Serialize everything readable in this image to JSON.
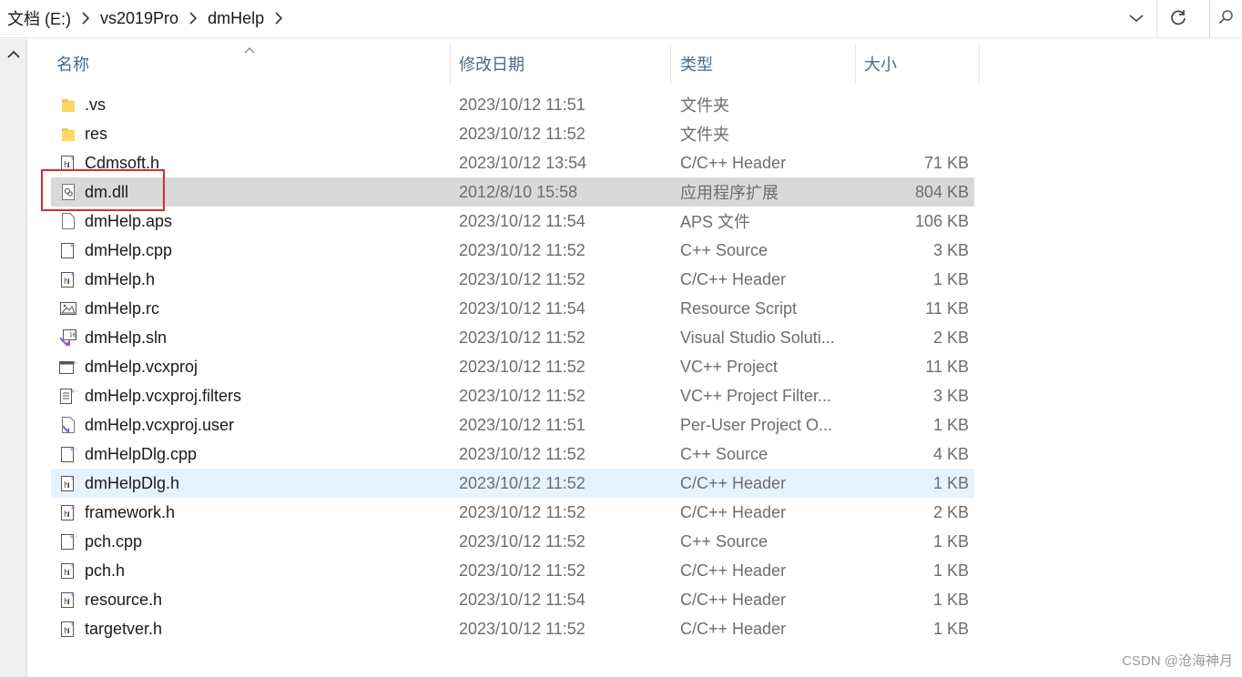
{
  "address": {
    "crumbs": [
      "文档 (E:)",
      "vs2019Pro",
      "dmHelp"
    ]
  },
  "columns": {
    "name": "名称",
    "date": "修改日期",
    "type": "类型",
    "size": "大小"
  },
  "files": [
    {
      "name": ".vs",
      "date": "2023/10/12 11:51",
      "type": "文件夹",
      "size": "",
      "icon": "folder-icon"
    },
    {
      "name": "res",
      "date": "2023/10/12 11:52",
      "type": "文件夹",
      "size": "",
      "icon": "folder-icon"
    },
    {
      "name": "Cdmsoft.h",
      "date": "2023/10/12 13:54",
      "type": "C/C++ Header",
      "size": "71 KB",
      "icon": "header-file-icon"
    },
    {
      "name": "dm.dll",
      "date": "2012/8/10 15:58",
      "type": "应用程序扩展",
      "size": "804 KB",
      "icon": "dll-file-icon"
    },
    {
      "name": "dmHelp.aps",
      "date": "2023/10/12 11:54",
      "type": "APS 文件",
      "size": "106 KB",
      "icon": "blank-file-icon"
    },
    {
      "name": "dmHelp.cpp",
      "date": "2023/10/12 11:52",
      "type": "C++ Source",
      "size": "3 KB",
      "icon": "cpp-file-icon"
    },
    {
      "name": "dmHelp.h",
      "date": "2023/10/12 11:52",
      "type": "C/C++ Header",
      "size": "1 KB",
      "icon": "header-file-icon"
    },
    {
      "name": "dmHelp.rc",
      "date": "2023/10/12 11:54",
      "type": "Resource Script",
      "size": "11 KB",
      "icon": "resource-file-icon"
    },
    {
      "name": "dmHelp.sln",
      "date": "2023/10/12 11:52",
      "type": "Visual Studio Soluti...",
      "size": "2 KB",
      "icon": "solution-file-icon"
    },
    {
      "name": "dmHelp.vcxproj",
      "date": "2023/10/12 11:52",
      "type": "VC++ Project",
      "size": "11 KB",
      "icon": "vcxproj-file-icon"
    },
    {
      "name": "dmHelp.vcxproj.filters",
      "date": "2023/10/12 11:52",
      "type": "VC++ Project Filter...",
      "size": "3 KB",
      "icon": "filters-file-icon"
    },
    {
      "name": "dmHelp.vcxproj.user",
      "date": "2023/10/12 11:51",
      "type": "Per-User Project O...",
      "size": "1 KB",
      "icon": "user-file-icon"
    },
    {
      "name": "dmHelpDlg.cpp",
      "date": "2023/10/12 11:52",
      "type": "C++ Source",
      "size": "4 KB",
      "icon": "cpp-file-icon"
    },
    {
      "name": "dmHelpDlg.h",
      "date": "2023/10/12 11:52",
      "type": "C/C++ Header",
      "size": "1 KB",
      "icon": "header-file-icon"
    },
    {
      "name": "framework.h",
      "date": "2023/10/12 11:52",
      "type": "C/C++ Header",
      "size": "2 KB",
      "icon": "header-file-icon"
    },
    {
      "name": "pch.cpp",
      "date": "2023/10/12 11:52",
      "type": "C++ Source",
      "size": "1 KB",
      "icon": "cpp-file-icon"
    },
    {
      "name": "pch.h",
      "date": "2023/10/12 11:52",
      "type": "C/C++ Header",
      "size": "1 KB",
      "icon": "header-file-icon"
    },
    {
      "name": "resource.h",
      "date": "2023/10/12 11:54",
      "type": "C/C++ Header",
      "size": "1 KB",
      "icon": "header-file-icon"
    },
    {
      "name": "targetver.h",
      "date": "2023/10/12 11:52",
      "type": "C/C++ Header",
      "size": "1 KB",
      "icon": "header-file-icon"
    }
  ],
  "watermark": "CSDN @沧海神月",
  "colors": {
    "selected_row": "#d9d9d9",
    "hover_row": "#e5f3ff",
    "highlight_box": "#e0282a",
    "header_text": "#4d6a8a"
  }
}
